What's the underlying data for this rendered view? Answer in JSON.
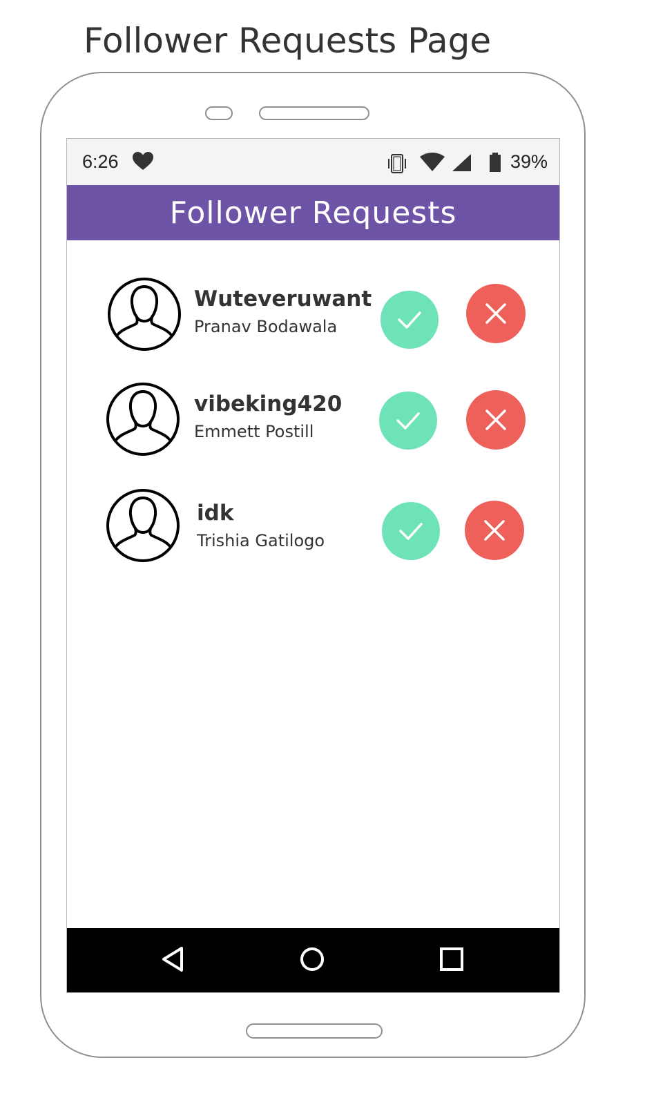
{
  "page_caption": "Follower Requests Page",
  "statusbar": {
    "time": "6:26",
    "battery_percent": "39%",
    "icons": [
      "heart-icon",
      "vibrate-icon",
      "wifi-icon",
      "signal-icon",
      "battery-icon"
    ]
  },
  "appbar": {
    "title": "Follower Requests",
    "color": "#6e54a6"
  },
  "colors": {
    "accept": "#6fe3b8",
    "reject": "#ee615b",
    "navbar": "#000000"
  },
  "requests": [
    {
      "username": "Wuteveruwant",
      "name": "Pranav Bodawala"
    },
    {
      "username": "vibeking420",
      "name": "Emmett Postill"
    },
    {
      "username": "idk",
      "name": "Trishia Gatilogo"
    }
  ],
  "navbar": {
    "icons": [
      "back-icon",
      "home-icon",
      "recents-icon"
    ]
  }
}
